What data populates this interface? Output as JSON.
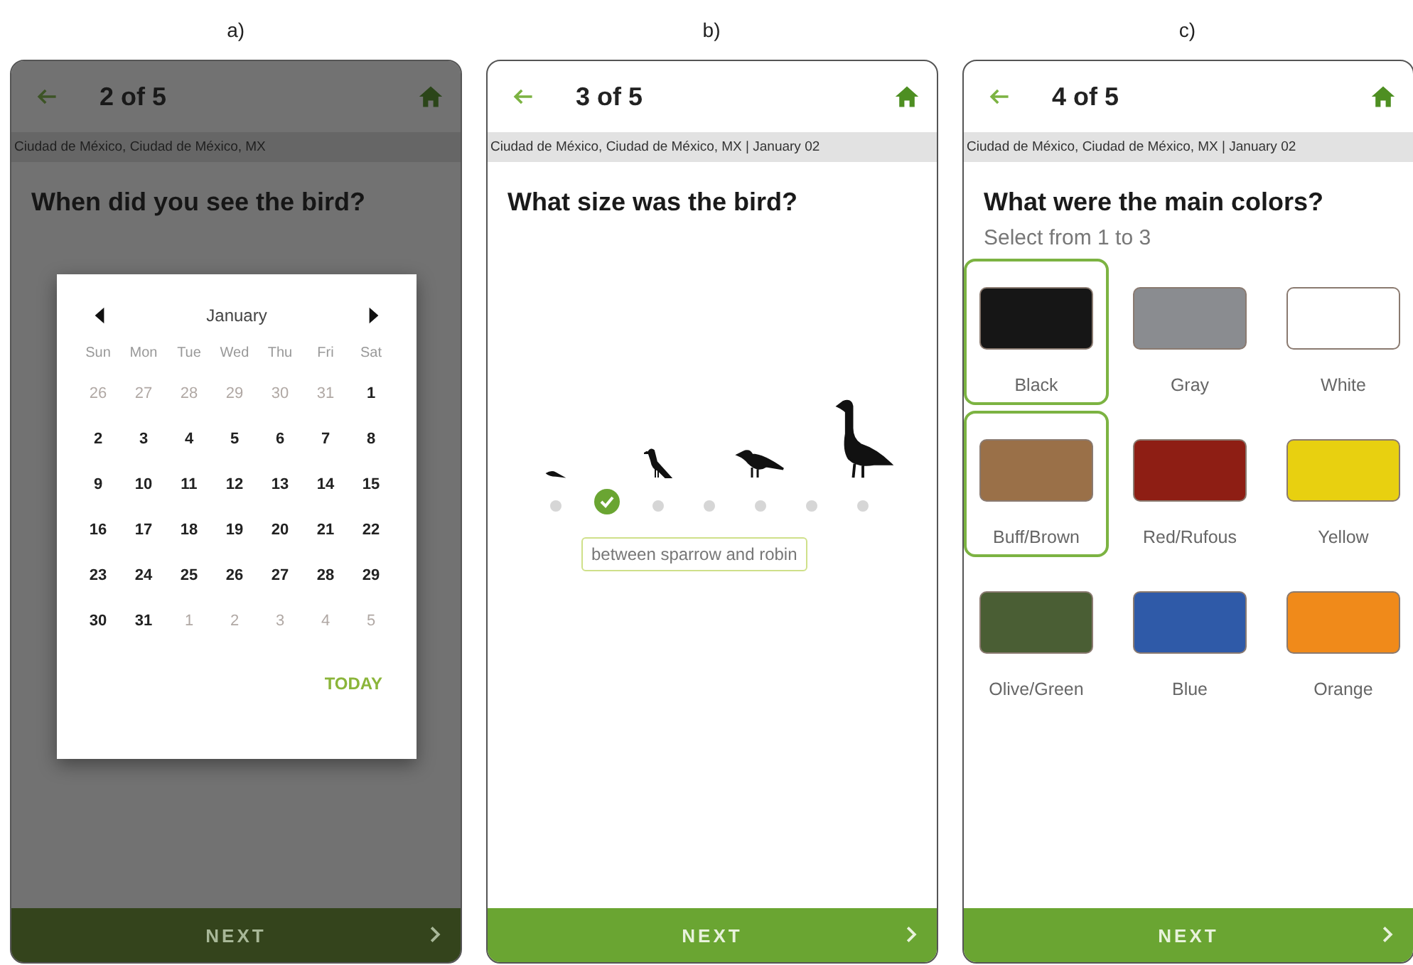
{
  "panels": [
    {
      "label": "a)",
      "kind": "date",
      "dimmed": true,
      "progress": "2 of 5",
      "location": "Ciudad de México, Ciudad de México, MX",
      "question": "When did you see the bird?",
      "calendar": {
        "month": "January",
        "weekdays": [
          "Sun",
          "Mon",
          "Tue",
          "Wed",
          "Thu",
          "Fri",
          "Sat"
        ],
        "days": [
          {
            "day": "26",
            "in_month": false
          },
          {
            "day": "27",
            "in_month": false
          },
          {
            "day": "28",
            "in_month": false
          },
          {
            "day": "29",
            "in_month": false
          },
          {
            "day": "30",
            "in_month": false
          },
          {
            "day": "31",
            "in_month": false
          },
          {
            "day": "1",
            "in_month": true
          },
          {
            "day": "2",
            "in_month": true
          },
          {
            "day": "3",
            "in_month": true
          },
          {
            "day": "4",
            "in_month": true
          },
          {
            "day": "5",
            "in_month": true
          },
          {
            "day": "6",
            "in_month": true
          },
          {
            "day": "7",
            "in_month": true
          },
          {
            "day": "8",
            "in_month": true
          },
          {
            "day": "9",
            "in_month": true
          },
          {
            "day": "10",
            "in_month": true
          },
          {
            "day": "11",
            "in_month": true
          },
          {
            "day": "12",
            "in_month": true
          },
          {
            "day": "13",
            "in_month": true
          },
          {
            "day": "14",
            "in_month": true
          },
          {
            "day": "15",
            "in_month": true
          },
          {
            "day": "16",
            "in_month": true
          },
          {
            "day": "17",
            "in_month": true
          },
          {
            "day": "18",
            "in_month": true
          },
          {
            "day": "19",
            "in_month": true
          },
          {
            "day": "20",
            "in_month": true
          },
          {
            "day": "21",
            "in_month": true
          },
          {
            "day": "22",
            "in_month": true
          },
          {
            "day": "23",
            "in_month": true
          },
          {
            "day": "24",
            "in_month": true
          },
          {
            "day": "25",
            "in_month": true
          },
          {
            "day": "26",
            "in_month": true
          },
          {
            "day": "27",
            "in_month": true
          },
          {
            "day": "28",
            "in_month": true
          },
          {
            "day": "29",
            "in_month": true
          },
          {
            "day": "30",
            "in_month": true
          },
          {
            "day": "31",
            "in_month": true
          },
          {
            "day": "1",
            "in_month": false
          },
          {
            "day": "2",
            "in_month": false
          },
          {
            "day": "3",
            "in_month": false
          },
          {
            "day": "4",
            "in_month": false
          },
          {
            "day": "5",
            "in_month": false
          }
        ],
        "today_button": "TODAY"
      },
      "next": {
        "label": "NEXT",
        "disabled": true
      }
    },
    {
      "label": "b)",
      "kind": "size",
      "dimmed": false,
      "progress": "3 of 5",
      "location": "Ciudad de México, Ciudad de México, MX | January 02",
      "question": "What size was the bird?",
      "size_slots": [
        {
          "selected": false
        },
        {
          "selected": true
        },
        {
          "selected": false
        },
        {
          "selected": false
        },
        {
          "selected": false
        },
        {
          "selected": false
        },
        {
          "selected": false
        }
      ],
      "size_label": "between sparrow and robin",
      "next": {
        "label": "NEXT",
        "disabled": false
      }
    },
    {
      "label": "c)",
      "kind": "colors",
      "dimmed": false,
      "progress": "4 of 5",
      "location": "Ciudad de México, Ciudad de México, MX | January 02",
      "question": "What were the main colors?",
      "hint": "Select from 1 to 3",
      "colors": [
        {
          "name": "Black",
          "color": "#161616",
          "selected": true
        },
        {
          "name": "Gray",
          "color": "#8a8c90",
          "selected": false
        },
        {
          "name": "White",
          "color": "#ffffff",
          "selected": false
        },
        {
          "name": "Buff/Brown",
          "color": "#9a7048",
          "selected": true
        },
        {
          "name": "Red/Rufous",
          "color": "#8e1e14",
          "selected": false
        },
        {
          "name": "Yellow",
          "color": "#e8d010",
          "selected": false
        },
        {
          "name": "Olive/Green",
          "color": "#4a5e34",
          "selected": false
        },
        {
          "name": "Blue",
          "color": "#2f5aa8",
          "selected": false
        },
        {
          "name": "Orange",
          "color": "#f08a1a",
          "selected": false
        }
      ],
      "next": {
        "label": "NEXT",
        "disabled": false
      }
    }
  ]
}
